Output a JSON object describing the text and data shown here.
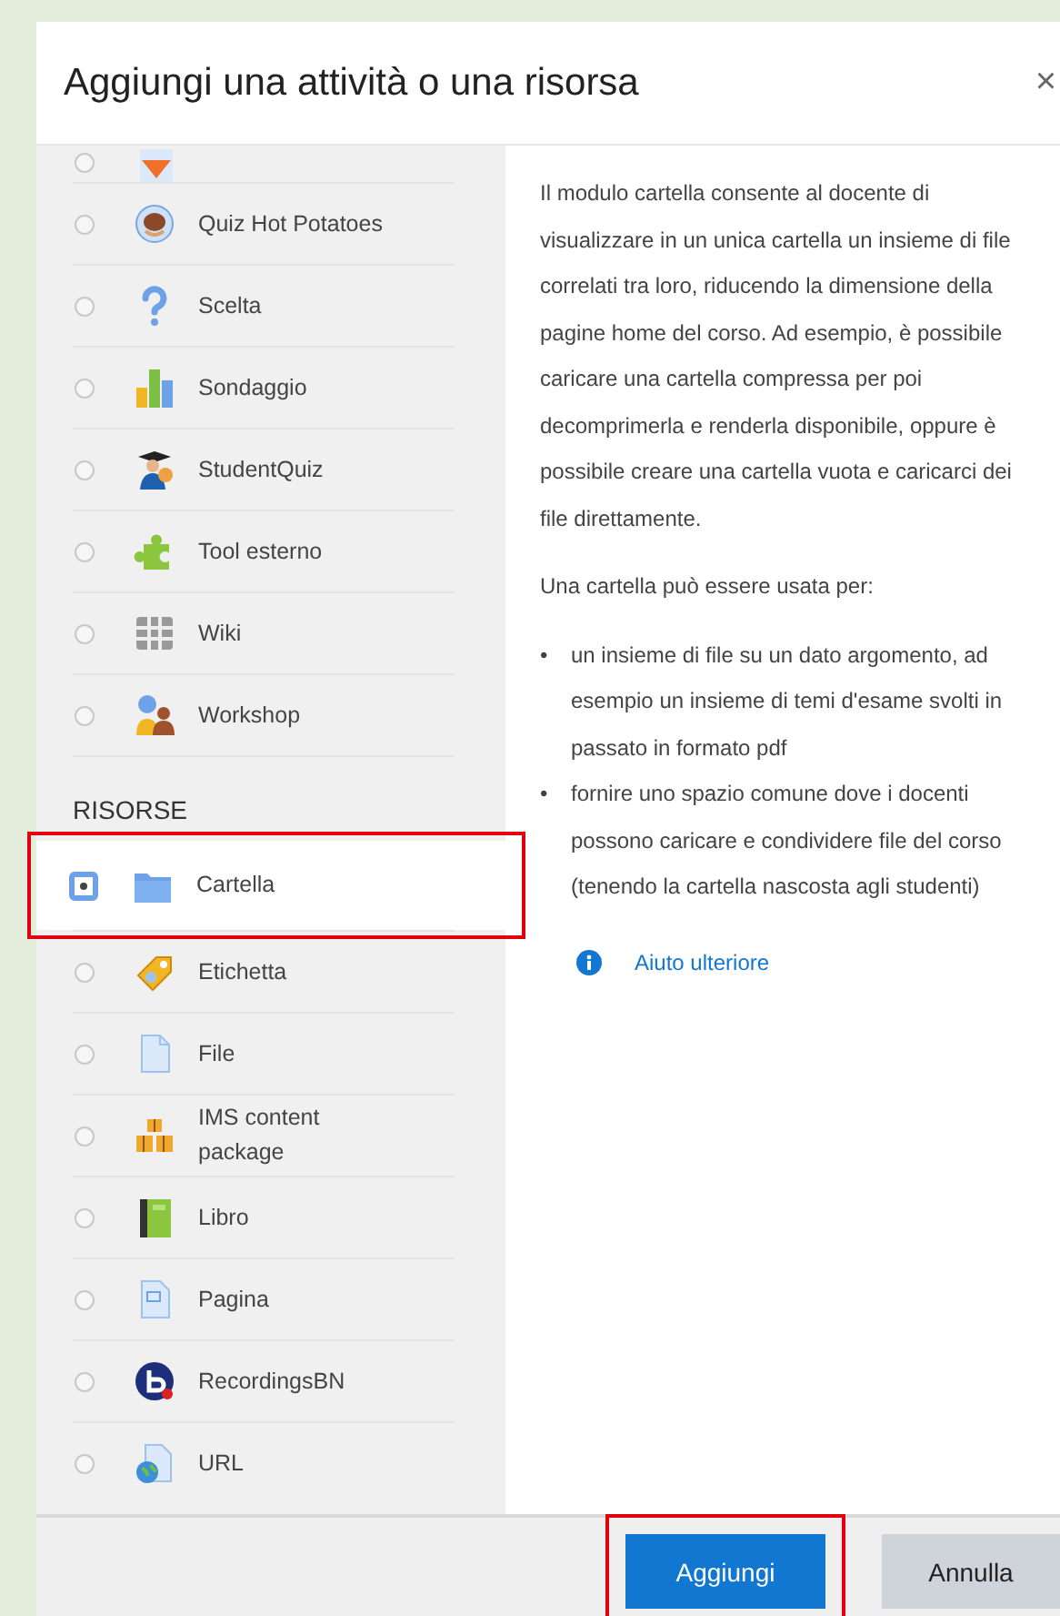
{
  "dialog": {
    "title": "Aggiungi una attività o una risorsa",
    "close": "×"
  },
  "partial_row": {
    "selected": false
  },
  "activities": [
    {
      "label": "Quiz Hot Potatoes",
      "selected": false,
      "highlighted": false
    },
    {
      "label": "Scelta",
      "selected": false,
      "highlighted": false
    },
    {
      "label": "Sondaggio",
      "selected": false,
      "highlighted": false
    },
    {
      "label": "StudentQuiz",
      "selected": false,
      "highlighted": false
    },
    {
      "label": "Tool esterno",
      "selected": false,
      "highlighted": false
    },
    {
      "label": "Wiki",
      "selected": false,
      "highlighted": false
    },
    {
      "label": "Workshop",
      "selected": false,
      "highlighted": false
    }
  ],
  "resources": {
    "heading": "RISORSE",
    "items": [
      {
        "label": "Cartella",
        "selected": true,
        "highlighted": true
      },
      {
        "label": "Etichetta",
        "selected": false,
        "highlighted": false
      },
      {
        "label": "File",
        "selected": false,
        "highlighted": false
      },
      {
        "label": "IMS content package",
        "selected": false,
        "highlighted": false
      },
      {
        "label": "Libro",
        "selected": false,
        "highlighted": false
      },
      {
        "label": "Pagina",
        "selected": false,
        "highlighted": false
      },
      {
        "label": "RecordingsBN",
        "selected": false,
        "highlighted": false
      },
      {
        "label": "URL",
        "selected": false,
        "highlighted": false
      }
    ]
  },
  "help": {
    "intro": "Il modulo cartella consente al docente di visualizzare in un unica cartella un insieme di file correlati tra loro, riducendo la dimensione della pagine home del corso. Ad esempio, è possibile caricare una cartella compressa per poi decomprimerla e renderla disponibile, oppure è possibile creare una cartella vuota e caricarci dei file direttamente.",
    "list_intro": "Una cartella può essere usata per:",
    "bullets": [
      {
        "marker": "•",
        "text": "un insieme di file su un dato argomento, ad esempio un insieme di temi d'esame svolti in passato in formato pdf"
      },
      {
        "marker": "•",
        "text": "fornire uno spazio comune dove i docenti possono caricare e condividere file del corso (tenendo la cartella nascosta agli studenti)"
      }
    ],
    "link": "Aiuto ulteriore"
  },
  "buttons": [
    {
      "label": "Aggiungi",
      "kind": "primary",
      "highlighted": true
    },
    {
      "label": "Annulla",
      "kind": "secondary",
      "highlighted": false
    }
  ]
}
